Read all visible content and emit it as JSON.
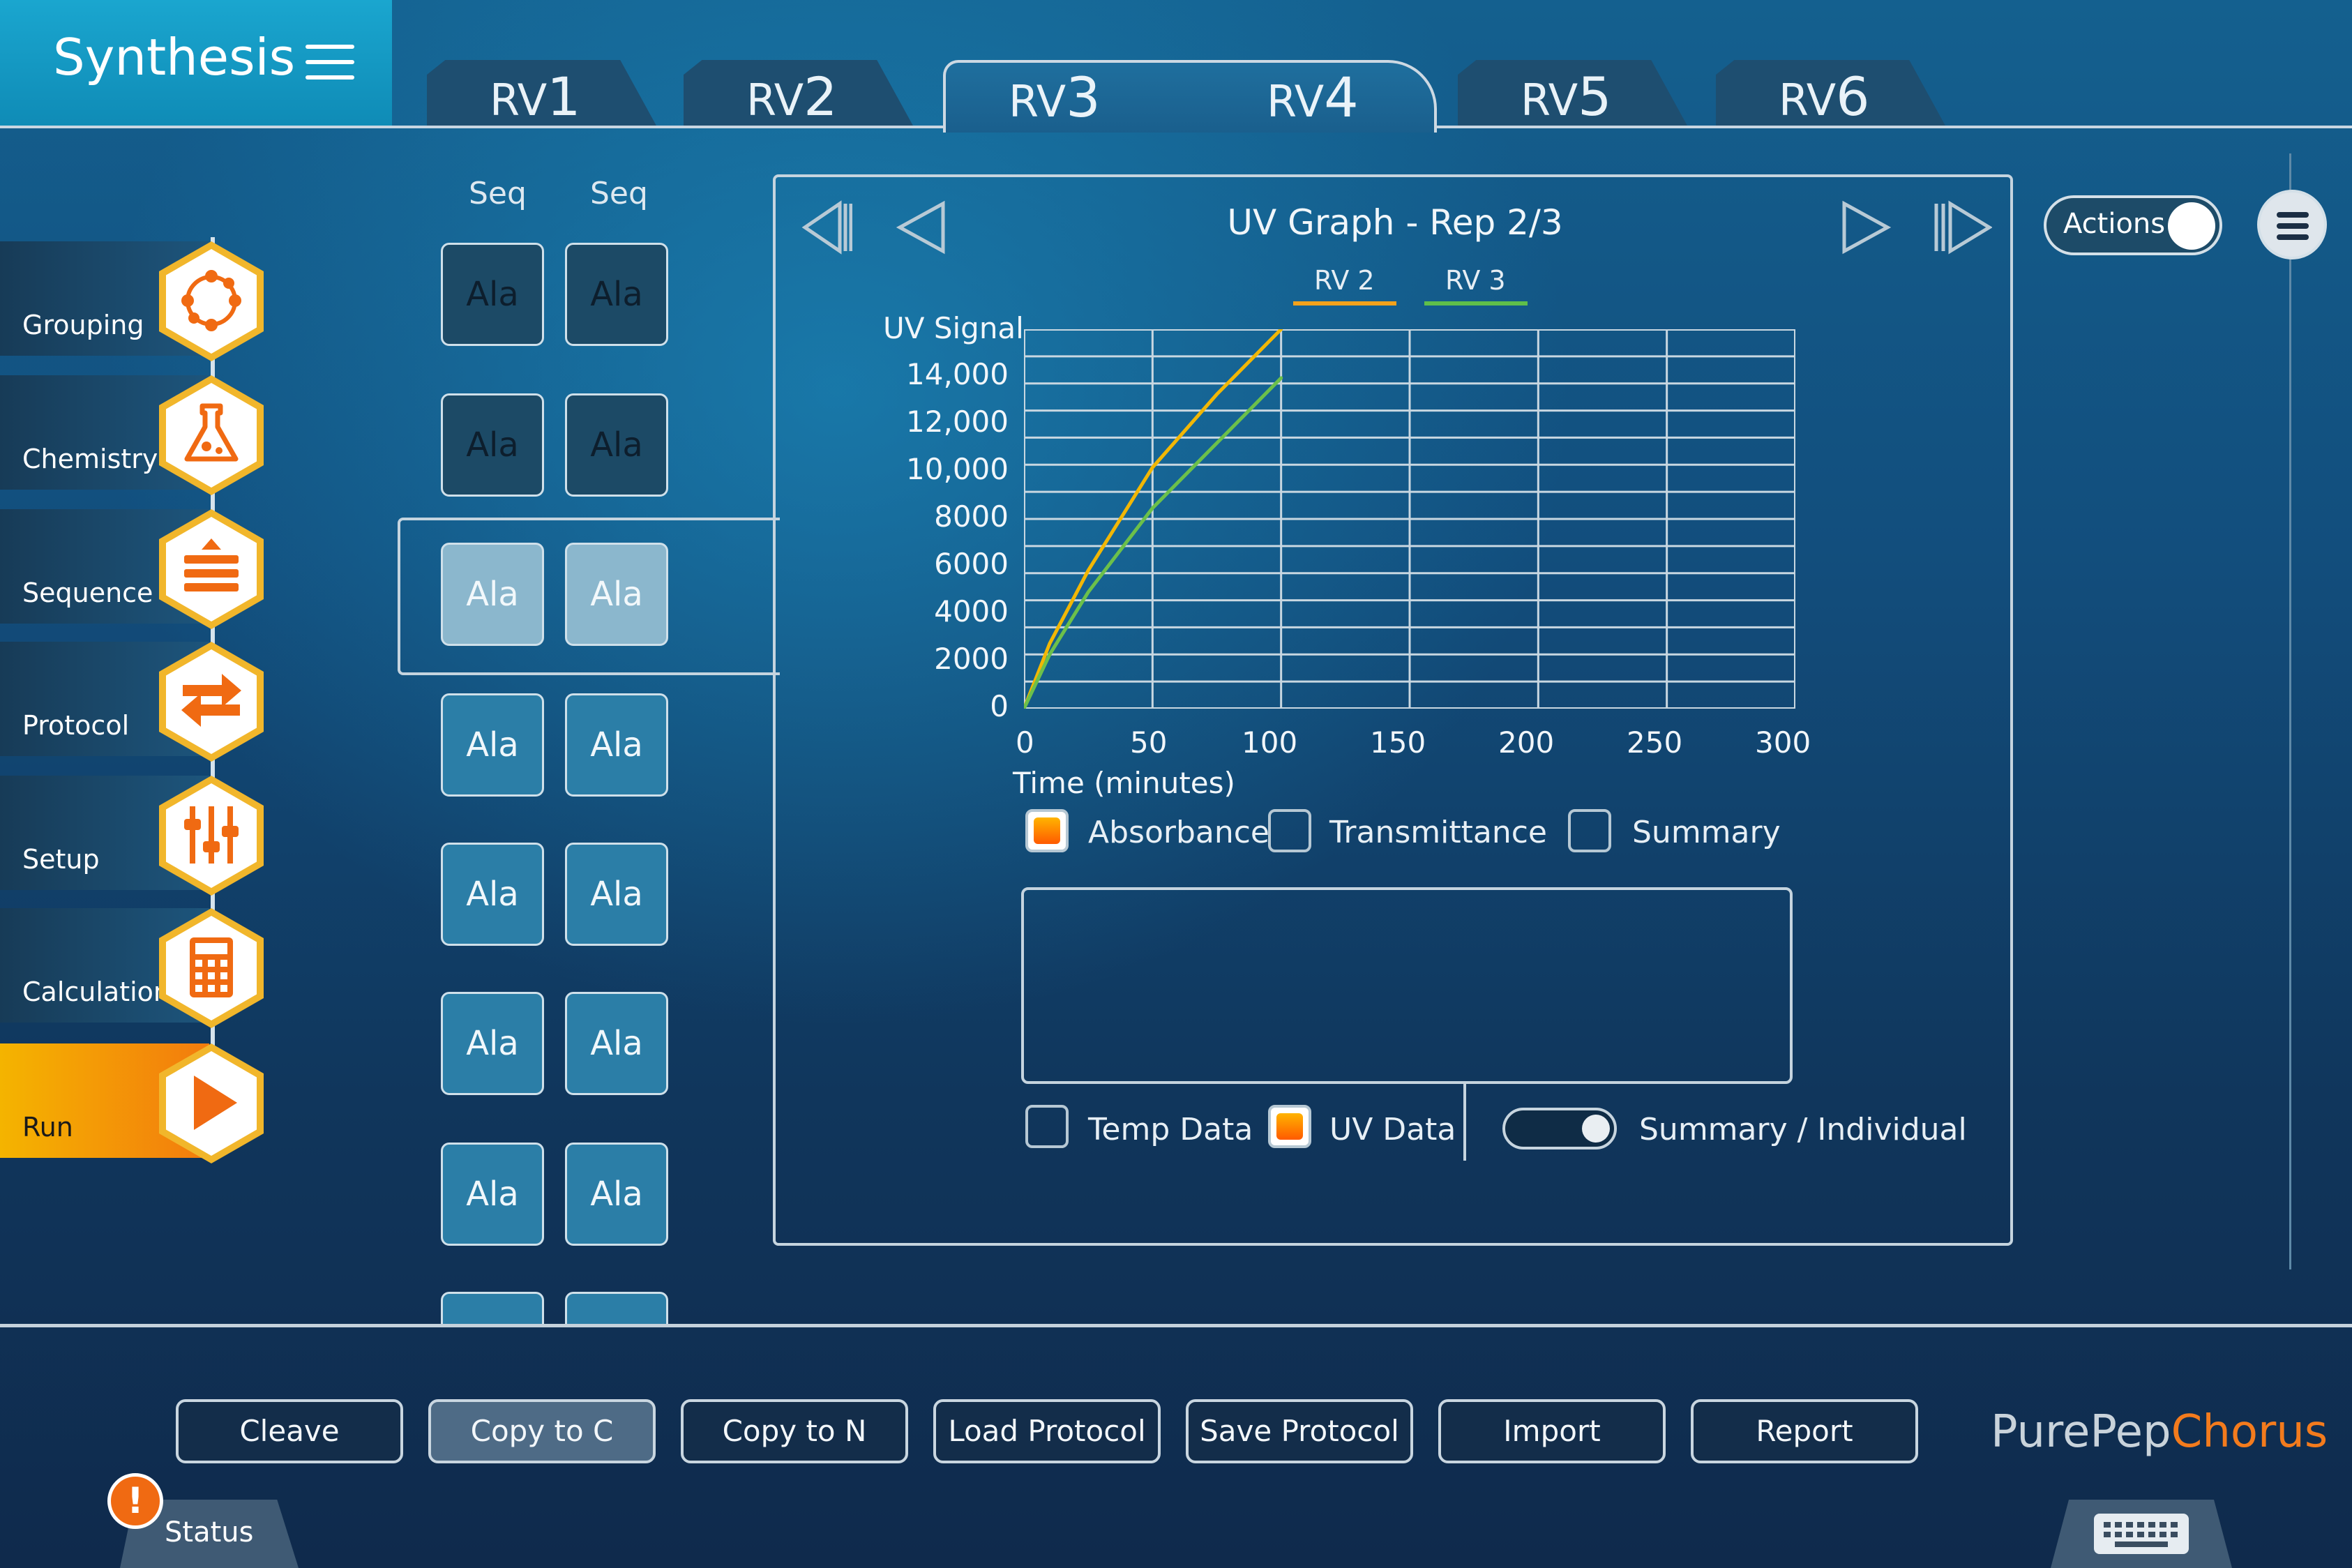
{
  "app": {
    "title": "Synthesis"
  },
  "tabs": [
    {
      "prefix": "RV",
      "num": "1"
    },
    {
      "prefix": "RV",
      "num": "2"
    },
    {
      "prefix": "RV",
      "num": "3"
    },
    {
      "prefix": "RV",
      "num": "4"
    },
    {
      "prefix": "RV",
      "num": "5"
    },
    {
      "prefix": "RV",
      "num": "6"
    }
  ],
  "sidebar": {
    "items": [
      {
        "label": "Grouping",
        "icon": "grouping-icon"
      },
      {
        "label": "Chemistry",
        "icon": "flask-icon"
      },
      {
        "label": "Sequence",
        "icon": "sequence-icon"
      },
      {
        "label": "Protocol",
        "icon": "protocol-icon"
      },
      {
        "label": "Setup",
        "icon": "sliders-icon"
      },
      {
        "label": "Calculation",
        "icon": "calculator-icon"
      },
      {
        "label": "Run",
        "icon": "play-icon"
      }
    ]
  },
  "sequence": {
    "headers": [
      "Seq",
      "Seq"
    ],
    "cells": [
      "Ala",
      "Ala",
      "Ala",
      "Ala",
      "Ala",
      "Ala",
      "Ala",
      "Ala",
      "Ala",
      "Ala",
      "Ala",
      "Ala",
      "Ala",
      "Ala"
    ]
  },
  "graph": {
    "title": "UV Graph - Rep 2/3",
    "legend": [
      {
        "name": "RV 2",
        "color": "#f2b705"
      },
      {
        "name": "RV 3",
        "color": "#5fbf4a"
      }
    ],
    "ylabel": "UV Signal",
    "xlabel": "Time (minutes)",
    "yticks": [
      "14,000",
      "12,000",
      "10,000",
      "8000",
      "6000",
      "4000",
      "2000",
      "0"
    ],
    "xticks": [
      "0",
      "50",
      "100",
      "150",
      "200",
      "250",
      "300"
    ],
    "options": {
      "absorbance": "Absorbance",
      "transmittance": "Transmittance",
      "summary": "Summary"
    },
    "bottom": {
      "temp": "Temp Data",
      "uv": "UV Data",
      "toggle": "Summary / Individual"
    }
  },
  "chart_data": {
    "type": "line",
    "title": "UV Graph - Rep 2/3",
    "xlabel": "Time (minutes)",
    "ylabel": "UV Signal",
    "xlim": [
      0,
      300
    ],
    "ylim": [
      0,
      14000
    ],
    "grid": true,
    "legend_position": "top",
    "series": [
      {
        "name": "RV 2",
        "color": "#f2b705",
        "x": [
          0,
          10,
          25,
          50,
          75,
          100
        ],
        "y": [
          0,
          2400,
          5100,
          8900,
          11600,
          14000
        ]
      },
      {
        "name": "RV 3",
        "color": "#6cc04a",
        "x": [
          0,
          10,
          25,
          50,
          75,
          100
        ],
        "y": [
          0,
          2000,
          4300,
          7400,
          9800,
          12200
        ]
      }
    ]
  },
  "actions": {
    "label": "Actions"
  },
  "buttons": [
    "Cleave",
    "Copy to C",
    "Copy to N",
    "Load Protocol",
    "Save Protocol",
    "Import",
    "Report"
  ],
  "logo": {
    "a": "PurePep",
    "b": "Chorus"
  },
  "status": {
    "label": "Status",
    "warn": "!"
  },
  "colors": {
    "accent": "#f06a12",
    "run_gradient": "#f4b400",
    "brand": "#1aa6cf"
  }
}
